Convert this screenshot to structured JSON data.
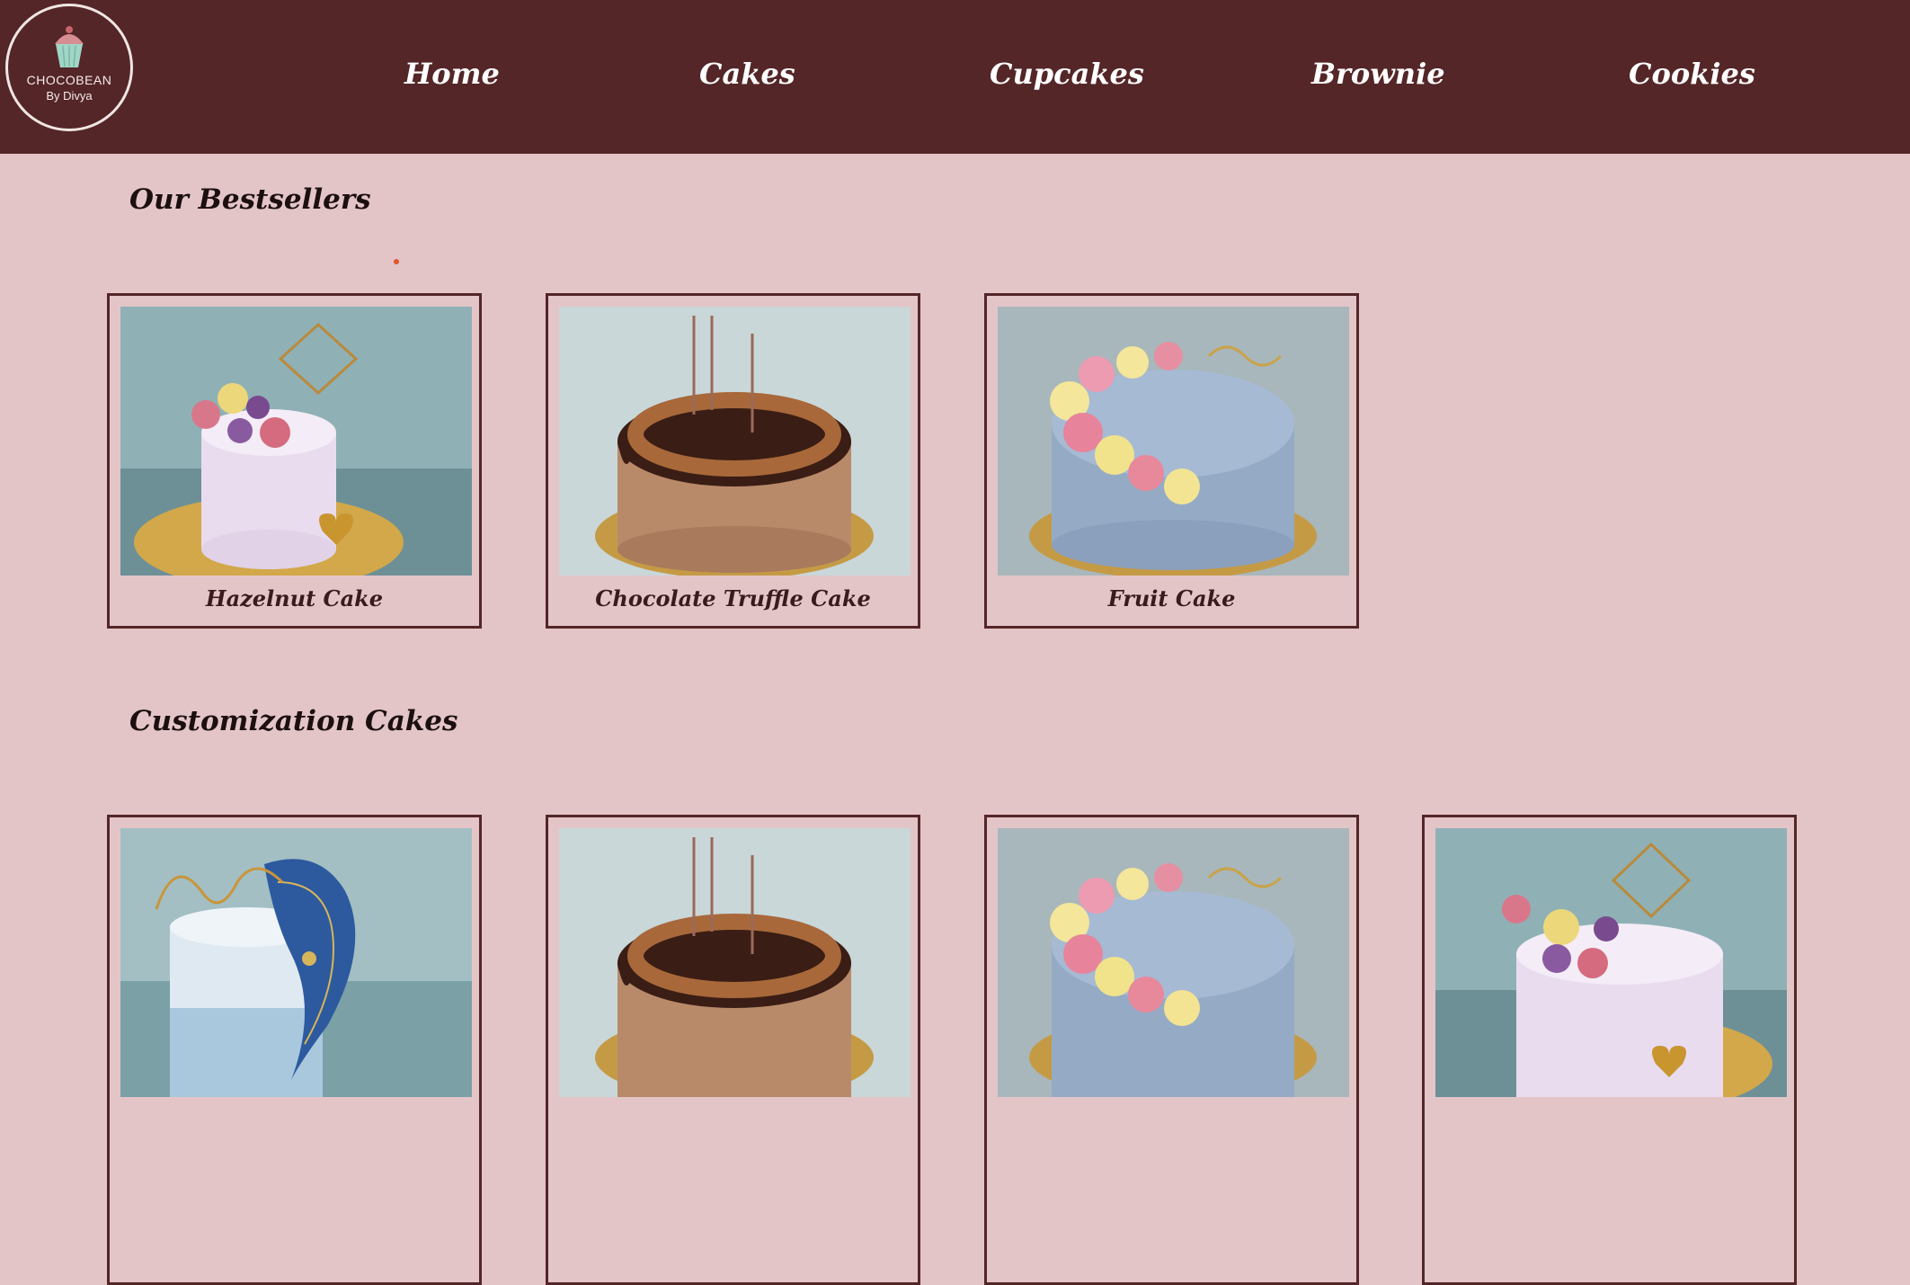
{
  "brand": {
    "name": "CHOCOBEAN",
    "byline": "By Divya"
  },
  "nav": [
    "Home",
    "Cakes",
    "Cupcakes",
    "Brownie",
    "Cookies"
  ],
  "sections": {
    "bestsellers": {
      "title": "Our Bestsellers",
      "items": [
        {
          "label": "Hazelnut Cake",
          "image": "hazelnut-cake-image"
        },
        {
          "label": "Chocolate Truffle Cake",
          "image": "chocolate-truffle-cake-image"
        },
        {
          "label": "Fruit Cake",
          "image": "fruit-cake-image"
        }
      ]
    },
    "customization": {
      "title": "Customization Cakes",
      "items": [
        {
          "image": "blue-birthday-cake-image"
        },
        {
          "image": "chocolate-truffle-cake-image"
        },
        {
          "image": "fruit-cake-image"
        },
        {
          "image": "hazelnut-cake-image"
        }
      ]
    }
  },
  "colors": {
    "header": "#542628",
    "background": "#e3c5c8",
    "card_border": "#542628",
    "accent_dot": "#e2542c"
  }
}
